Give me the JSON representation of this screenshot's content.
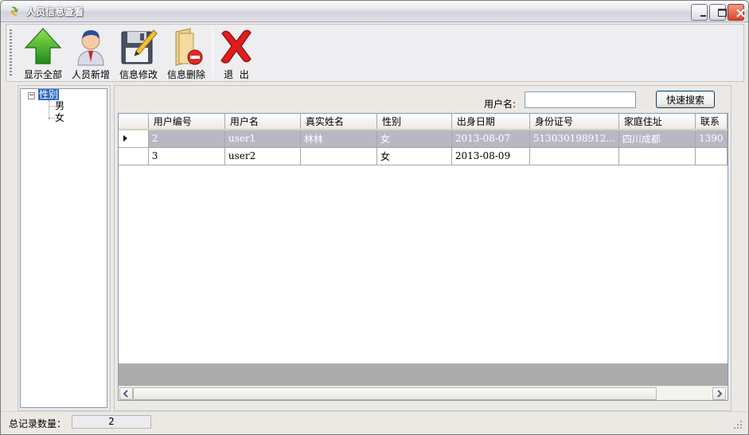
{
  "window": {
    "title": "人员信息查看",
    "icon": "app-arrows-icon"
  },
  "toolbar": {
    "items": [
      {
        "label": "显示全部",
        "icon": "green-up-arrow-icon"
      },
      {
        "label": "人员新增",
        "icon": "user-avatar-icon"
      },
      {
        "label": "信息修改",
        "icon": "floppy-pencil-icon"
      },
      {
        "label": "信息删除",
        "icon": "folder-delete-icon"
      },
      {
        "label": "退  出",
        "icon": "red-x-icon"
      }
    ]
  },
  "tree": {
    "root": "性别",
    "children": [
      "男",
      "女"
    ]
  },
  "search": {
    "label": "用户名:",
    "value": "",
    "button": "快速搜索"
  },
  "grid": {
    "columns": [
      "用户编号",
      "用户名",
      "真实姓名",
      "性别",
      "出身日期",
      "身份证号",
      "家庭住址",
      "联系"
    ],
    "rows": [
      [
        "2",
        "user1",
        "林林",
        "女",
        "2013-08-07",
        "513030198912...",
        "四川成都",
        "1390"
      ],
      [
        "3",
        "user2",
        "",
        "女",
        "2013-08-09",
        "",
        "",
        ""
      ]
    ],
    "selected_row": 0
  },
  "status": {
    "label": "总记录数量：",
    "count": "2"
  },
  "colors": {
    "selection": "#316ac5",
    "selected_row": "#b9b7c5",
    "border": "#7f9db9"
  }
}
